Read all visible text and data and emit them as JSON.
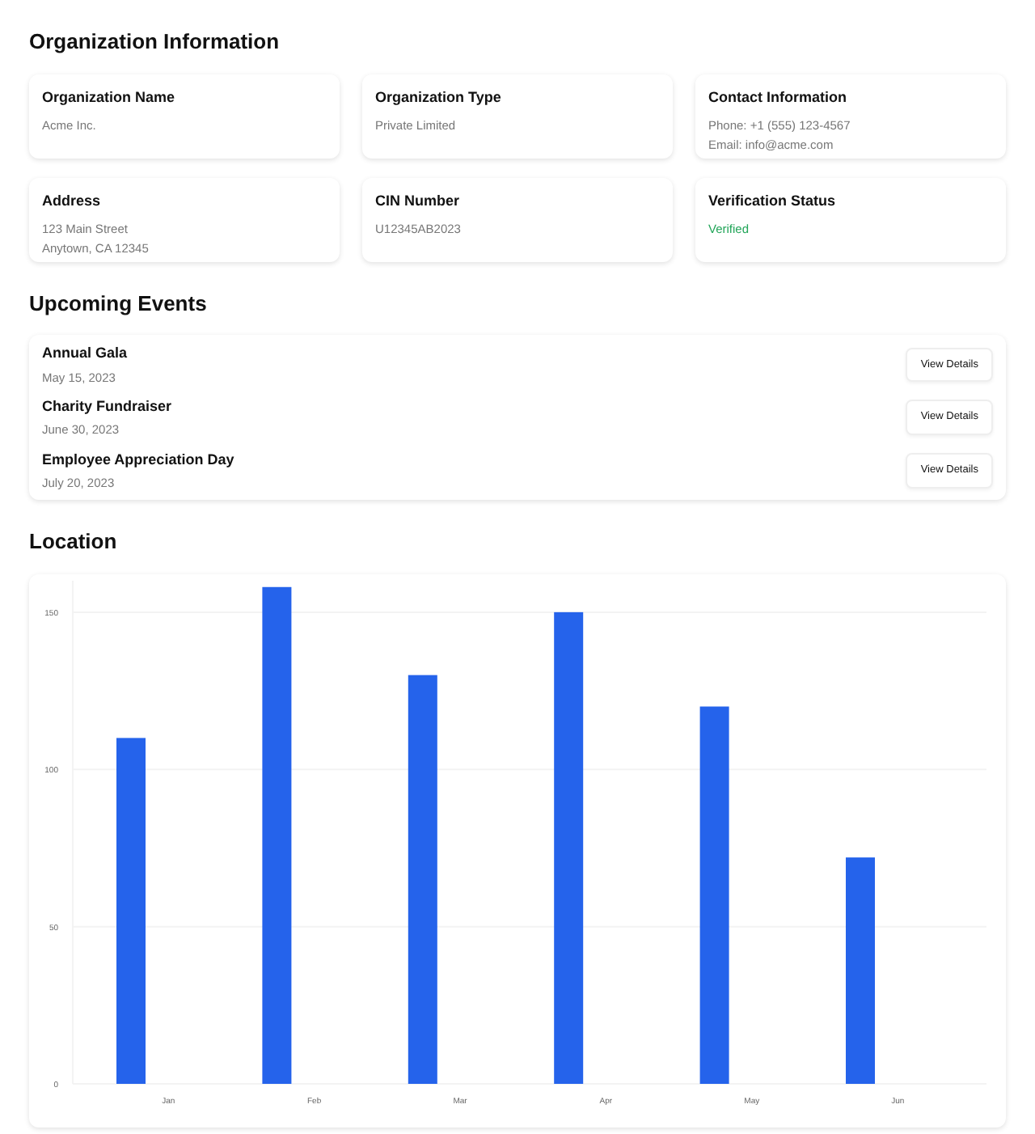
{
  "organization": {
    "title": "Organization Information",
    "fields": [
      {
        "label": "Organization Name",
        "lines": [
          "Acme Inc."
        ],
        "kind": "plain"
      },
      {
        "label": "Organization Type",
        "lines": [
          "Private Limited"
        ],
        "kind": "plain"
      },
      {
        "label": "Contact Information",
        "lines": [
          "Phone: +1 (555) 123-4567",
          "Email: info@acme.com"
        ],
        "kind": "plain"
      },
      {
        "label": "Address",
        "lines": [
          "123 Main Street",
          "Anytown, CA 12345"
        ],
        "kind": "plain"
      },
      {
        "label": "CIN Number",
        "lines": [
          "U12345AB2023"
        ],
        "kind": "plain"
      },
      {
        "label": "Verification Status",
        "lines": [
          "Verified"
        ],
        "kind": "status"
      }
    ]
  },
  "events": {
    "title": "Upcoming Events",
    "items": [
      {
        "name": "Annual Gala",
        "date": "May 15, 2023",
        "button": "View Details"
      },
      {
        "name": "Charity Fundraiser",
        "date": "June 30, 2023",
        "button": "View Details"
      },
      {
        "name": "Employee Appreciation Day",
        "date": "July 20, 2023",
        "button": "View Details"
      }
    ]
  },
  "location": {
    "title": "Location",
    "chart_data": {
      "type": "bar",
      "categories": [
        "Jan",
        "Feb",
        "Mar",
        "Apr",
        "May",
        "Jun"
      ],
      "values": [
        110,
        158,
        130,
        150,
        120,
        72
      ],
      "ylim": [
        0,
        160
      ],
      "yticks": [
        0,
        50,
        100,
        150
      ],
      "grid": true
    }
  }
}
